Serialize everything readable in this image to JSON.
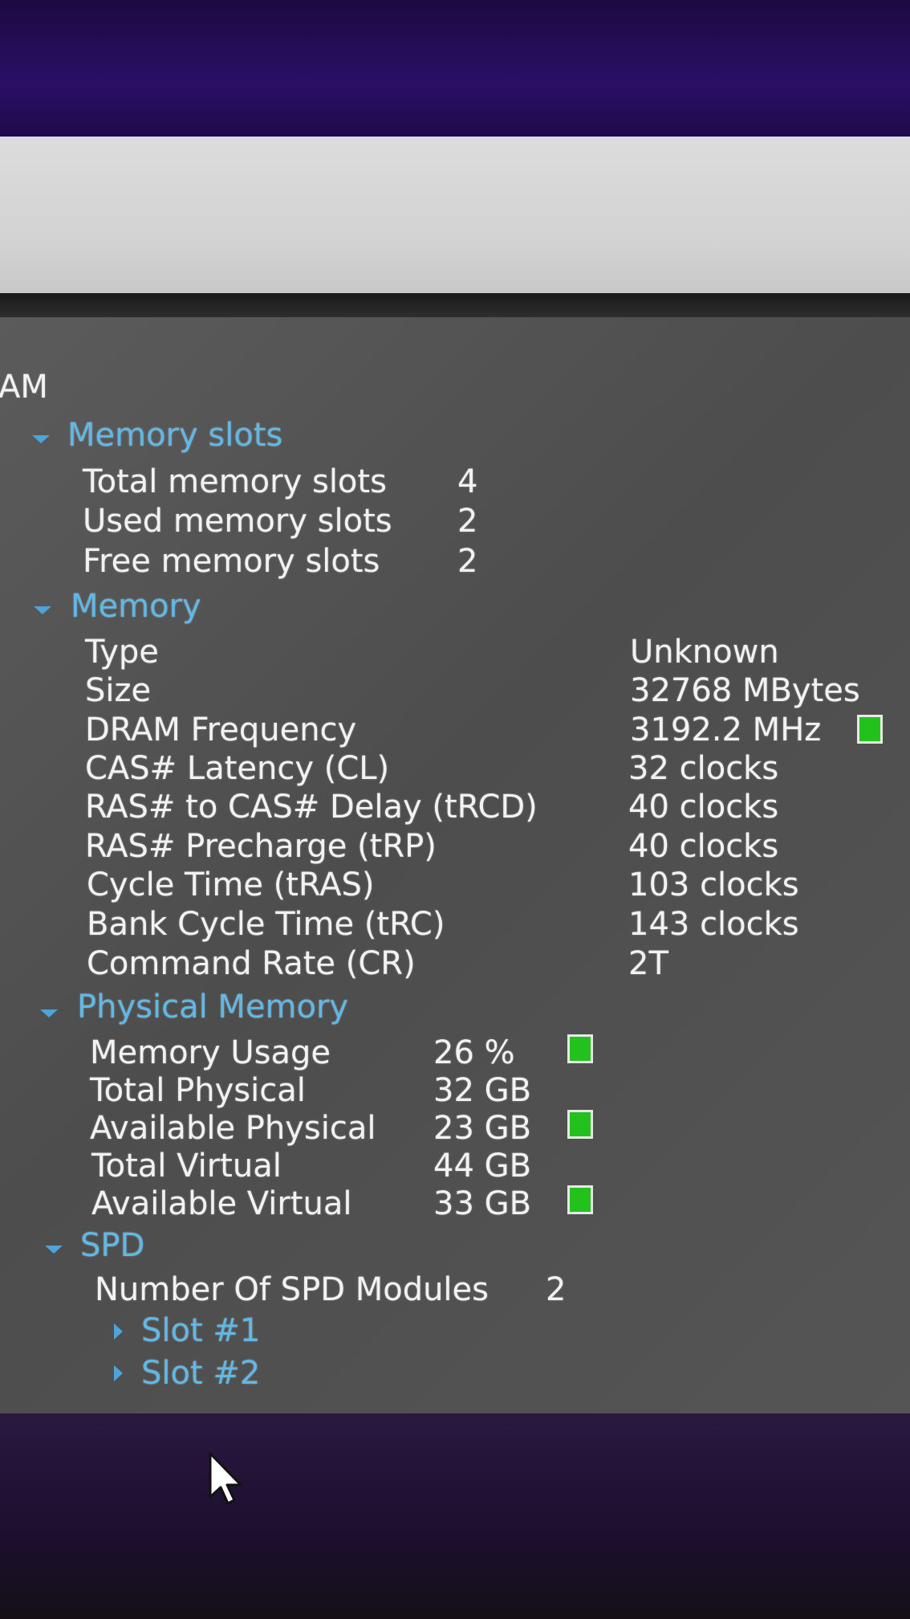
{
  "root_label": "AM",
  "memory_slots": {
    "header": "Memory slots",
    "rows": [
      {
        "label": "Total memory slots",
        "value": "4"
      },
      {
        "label": "Used memory slots",
        "value": "2"
      },
      {
        "label": "Free memory slots",
        "value": "2"
      }
    ]
  },
  "memory": {
    "header": "Memory",
    "rows": [
      {
        "label": "Type",
        "value": "Unknown"
      },
      {
        "label": "Size",
        "value": "32768 MBytes"
      },
      {
        "label": "DRAM Frequency",
        "value": "3192.2 MHz",
        "indicator": "green-bar-icon"
      },
      {
        "label": "CAS# Latency (CL)",
        "value": "32 clocks"
      },
      {
        "label": "RAS# to CAS# Delay (tRCD)",
        "value": "40 clocks"
      },
      {
        "label": "RAS# Precharge (tRP)",
        "value": "40 clocks"
      },
      {
        "label": "Cycle Time (tRAS)",
        "value": "103 clocks"
      },
      {
        "label": "Bank Cycle Time (tRC)",
        "value": "143 clocks"
      },
      {
        "label": "Command Rate (CR)",
        "value": "2T"
      }
    ]
  },
  "physical_memory": {
    "header": "Physical Memory",
    "rows": [
      {
        "label": "Memory Usage",
        "value": "26 %",
        "indicator": "green-bar-icon"
      },
      {
        "label": "Total Physical",
        "value": "32 GB"
      },
      {
        "label": "Available Physical",
        "value": "23 GB",
        "indicator": "green-bar-icon"
      },
      {
        "label": "Total Virtual",
        "value": "44 GB"
      },
      {
        "label": "Available Virtual",
        "value": "33 GB",
        "indicator": "green-bar-icon"
      }
    ]
  },
  "spd": {
    "header": "SPD",
    "modules_label": "Number Of SPD Modules",
    "modules_value": "2",
    "slots": [
      "Slot #1",
      "Slot #2"
    ]
  },
  "colors": {
    "header_text": "#5fb8e6",
    "indicator_green": "#22c11c",
    "panel_bg": "#555555"
  }
}
